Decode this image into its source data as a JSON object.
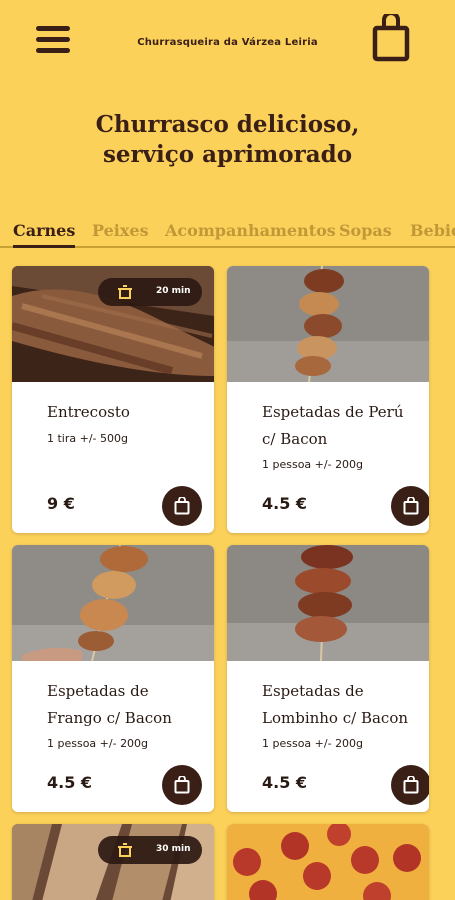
{
  "header": {
    "shop_name": "Churrasqueira da Várzea Leiria",
    "menu_icon": "hamburger-menu-icon",
    "bag_icon": "shopping-bag-icon"
  },
  "hero": {
    "line1": "Churrasco delicioso,",
    "line2": "serviço aprimorado"
  },
  "tabs": [
    {
      "label": "Carnes",
      "active": true
    },
    {
      "label": "Peixes",
      "active": false
    },
    {
      "label": "Acompanhamentos",
      "active": false
    },
    {
      "label": "Sopas",
      "active": false
    },
    {
      "label": "Bebid",
      "active": false
    }
  ],
  "products": [
    {
      "name_line1": "Entrecosto",
      "name_line2": "",
      "desc": "1 tira  +/- 500g",
      "price": "9 €",
      "badge": "20 min",
      "image": "grilled-ribs-photo"
    },
    {
      "name_line1": "Espetadas de Perú",
      "name_line2": "c/ Bacon",
      "desc": "1 pessoa  +/- 200g",
      "price": "4.5 €",
      "badge": "",
      "image": "turkey-bacon-skewer-photo"
    },
    {
      "name_line1": "Espetadas de",
      "name_line2": "Frango c/ Bacon",
      "desc": "1 pessoa  +/- 200g",
      "price": "4.5 €",
      "badge": "",
      "image": "chicken-bacon-skewer-photo"
    },
    {
      "name_line1": "Espetadas de",
      "name_line2": "Lombinho c/ Bacon",
      "desc": "1 pessoa  +/- 200g",
      "price": "4.5 €",
      "badge": "",
      "image": "pork-bacon-skewer-photo"
    },
    {
      "name_line1": "",
      "name_line2": "",
      "desc": "",
      "price": "",
      "badge": "30 min",
      "image": "grilled-meat-photo"
    },
    {
      "name_line1": "",
      "name_line2": "",
      "desc": "",
      "price": "",
      "badge": "",
      "image": "pepperoni-pizza-photo"
    }
  ],
  "colors": {
    "background": "#fcd15a",
    "accent": "#3a1f17",
    "tab_inactive": "#c19838",
    "card": "#ffffff"
  }
}
